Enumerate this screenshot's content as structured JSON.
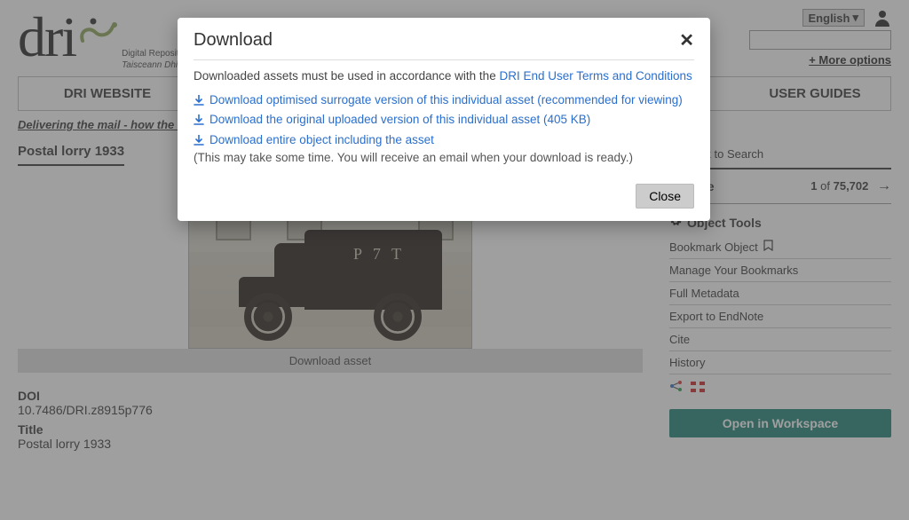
{
  "header": {
    "logo_text": "dri",
    "sub1": "Digital Repository",
    "sub2": "Taisceann Dhigiteach",
    "language": "English",
    "more_options": "+ More options"
  },
  "topnav": {
    "left": "DRI WEBSITE",
    "right": "USER GUIDES"
  },
  "breadcrumb": "Delivering the mail - how the P...",
  "page_title": "Postal lorry 1933",
  "viewer": {
    "download_asset": "Download asset",
    "vehicle_mark": "P 7 T"
  },
  "metadata": {
    "doi_label": "DOI",
    "doi_value": "10.7486/DRI.z8915p776",
    "title_label": "Title",
    "title_value": "Postal lorry 1933"
  },
  "right": {
    "back_to_search": "Back to Search",
    "browse_label": "Browse",
    "browse_pos": "1",
    "browse_of": "of",
    "browse_total": "75,702",
    "obj_tools": "Object Tools",
    "tools": [
      "Bookmark Object",
      "Manage Your Bookmarks",
      "Full Metadata",
      "Export to EndNote",
      "Cite",
      "History"
    ],
    "open_workspace": "Open in Workspace"
  },
  "modal": {
    "title": "Download",
    "intro_prefix": "Downloaded assets must be used in accordance with the ",
    "intro_link": "DRI End User Terms and Conditions",
    "opt1": "Download optimised surrogate version of this individual asset (recommended for viewing)",
    "opt2": "Download the original uploaded version of this individual asset (405 KB)",
    "opt3": "Download entire object including the asset",
    "note": "(This may take some time. You will receive an email when your download is ready.)",
    "close": "Close"
  }
}
